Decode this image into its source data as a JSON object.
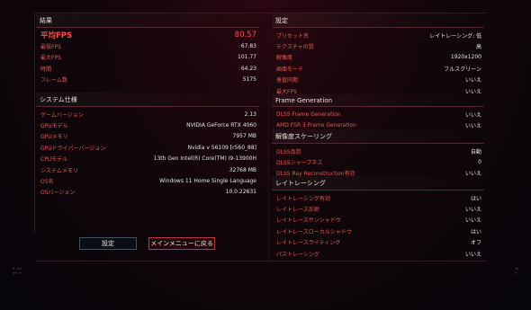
{
  "results": {
    "title": "結果",
    "rows": [
      {
        "label": "平均FPS",
        "value": "80.57"
      },
      {
        "label": "最低FPS",
        "value": "67.83"
      },
      {
        "label": "最大FPS",
        "value": "101.77"
      },
      {
        "label": "時間",
        "value": "64.23"
      },
      {
        "label": "フレーム数",
        "value": "5175"
      }
    ]
  },
  "system": {
    "title": "システム仕様",
    "rows": [
      {
        "label": "ゲームバージョン",
        "value": "2.13"
      },
      {
        "label": "GPUモデル",
        "value": "NVIDIA GeForce RTX 4060"
      },
      {
        "label": "GPUメモリ",
        "value": "7957 MB"
      },
      {
        "label": "GPUドライバーバージョン",
        "value": "Nvidia v 56109 [r560_88]"
      },
      {
        "label": "CPUモデル",
        "value": "13th Gen Intel(R) Core(TM) i9-13900H"
      },
      {
        "label": "システムメモリ",
        "value": "32768 MB"
      },
      {
        "label": "OS名",
        "value": "Windows 11 Home Single Language"
      },
      {
        "label": "OSバージョン",
        "value": "10.0.22631"
      }
    ]
  },
  "settings": {
    "title": "設定",
    "rows": [
      {
        "label": "プリセット名",
        "value": "レイトレーシング: 低"
      },
      {
        "label": "テクスチャの質",
        "value": "高"
      },
      {
        "label": "解像度",
        "value": "1920x1200"
      },
      {
        "label": "画面モード",
        "value": "フルスクリーン"
      },
      {
        "label": "垂直同期",
        "value": "いいえ"
      },
      {
        "label": "最大FPS",
        "value": "いいえ"
      }
    ]
  },
  "frame_generation": {
    "title": "Frame Generation",
    "rows": [
      {
        "label": "DLSS Frame Generation",
        "value": "いいえ"
      },
      {
        "label": "AMD FSR 3 Frame Generation",
        "value": "いいえ"
      }
    ]
  },
  "scaling": {
    "title": "解像度スケーリング",
    "rows": [
      {
        "label": "DLSS品質",
        "value": "自動"
      },
      {
        "label": "DLSSシャープネス",
        "value": "0"
      },
      {
        "label": "DLSS Ray Reconstruction有効",
        "value": "いいえ"
      }
    ]
  },
  "raytracing": {
    "title": "レイトレーシング",
    "rows": [
      {
        "label": "レイトレーシング有効",
        "value": "はい"
      },
      {
        "label": "レイトレース反射",
        "value": "いいえ"
      },
      {
        "label": "レイトレースサンシャドウ",
        "value": "いいえ"
      },
      {
        "label": "レイトレースローカルシャドウ",
        "value": "はい"
      },
      {
        "label": "レイトレースライティング",
        "value": "オフ"
      },
      {
        "label": "パストレーシング",
        "value": "いいえ"
      }
    ]
  },
  "buttons": {
    "settings": "設定",
    "main_menu": "メインメニューに戻る"
  }
}
